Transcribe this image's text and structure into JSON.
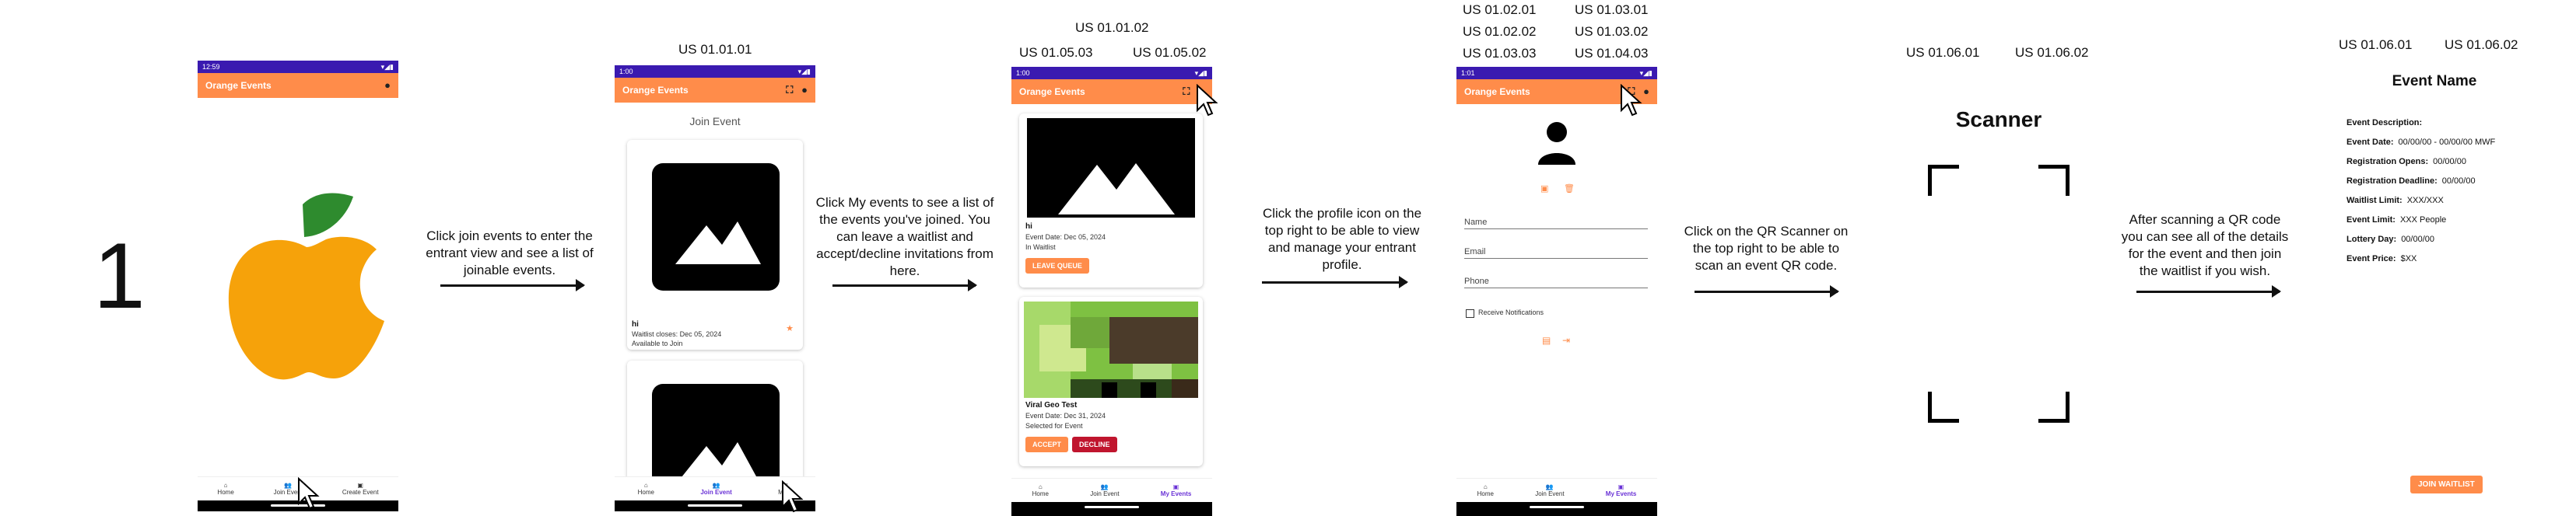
{
  "step_number": "1",
  "app_title": "Orange Events",
  "status_time": "12:59",
  "status_time_2": "1:00",
  "status_time_3": "1:01",
  "colors": {
    "app_bar": "#ff8c4a",
    "status_bar": "#3a1ab0",
    "nav_active": "#6a32d6",
    "decline": "#c0152e",
    "apple": "#f6a20a",
    "leaf": "#2e8b2e"
  },
  "story_labels": {
    "join_event": "US 01.01.01",
    "my_events_top": "US 01.01.02",
    "my_events_left": "US 01.05.03",
    "my_events_right": "US 01.05.02",
    "profile_1": "US 01.02.01",
    "profile_2": "US 01.03.01",
    "profile_3": "US 01.02.02",
    "profile_4": "US 01.03.02",
    "profile_5": "US 01.03.03",
    "profile_6": "US 01.04.03",
    "scanner_1": "US 01.06.01",
    "scanner_2": "US 01.06.02",
    "details_1": "US 01.06.01",
    "details_2": "US 01.06.02"
  },
  "captions": {
    "c1": "Click join events to enter the entrant view and see a list of joinable events.",
    "c2": "Click My events to see a list of the events you've joined. You can leave a waitlist and accept/decline invitations from here.",
    "c3": "Click the profile icon on the top right to be able to view and manage your entrant profile.",
    "c4": "Click on the QR Scanner on the top right to be able to scan an event QR code.",
    "c5": "After scanning a QR code you can see all of the details for the event and then join the waitlist if you wish."
  },
  "nav": {
    "home": "Home",
    "join_event": "Join Event",
    "create_event": "Create Event",
    "my_events": "My Events",
    "my_events_short": "My E"
  },
  "join_screen": {
    "heading": "Join Event",
    "event_name": "hi",
    "waitlist_closes": "Waitlist closes: Dec 05, 2024",
    "availability": "Available to Join",
    "star": "★"
  },
  "my_events_screen": {
    "event1_name": "hi",
    "event1_date": "Event Date: Dec 05, 2024",
    "event1_status": "In Waitlist",
    "leave_button": "LEAVE QUEUE",
    "event2_name": "Viral Geo Test",
    "event2_date": "Event Date: Dec 31, 2024",
    "event2_status": "Selected for Event",
    "accept_button": "ACCEPT",
    "decline_button": "DECLINE"
  },
  "profile_screen": {
    "name_label": "Name",
    "email_label": "Email",
    "phone_label": "Phone",
    "notifications_label": "Receive Notifications"
  },
  "scanner_screen": {
    "title": "Scanner"
  },
  "details_screen": {
    "title": "Event Name",
    "rows": [
      {
        "label": "Event Description:",
        "value": ""
      },
      {
        "label": "Event Date:",
        "value": "00/00/00 - 00/00/00 MWF"
      },
      {
        "label": "Registration Opens:",
        "value": "00/00/00"
      },
      {
        "label": "Registration Deadline:",
        "value": "00/00/00"
      },
      {
        "label": "Waitlist Limit:",
        "value": "XXX/XXX"
      },
      {
        "label": "Event Limit:",
        "value": "XXX People"
      },
      {
        "label": "Lottery Day:",
        "value": "00/00/00"
      },
      {
        "label": "Event Price:",
        "value": "$XX"
      }
    ],
    "join_button": "JOIN WAITLIST"
  }
}
